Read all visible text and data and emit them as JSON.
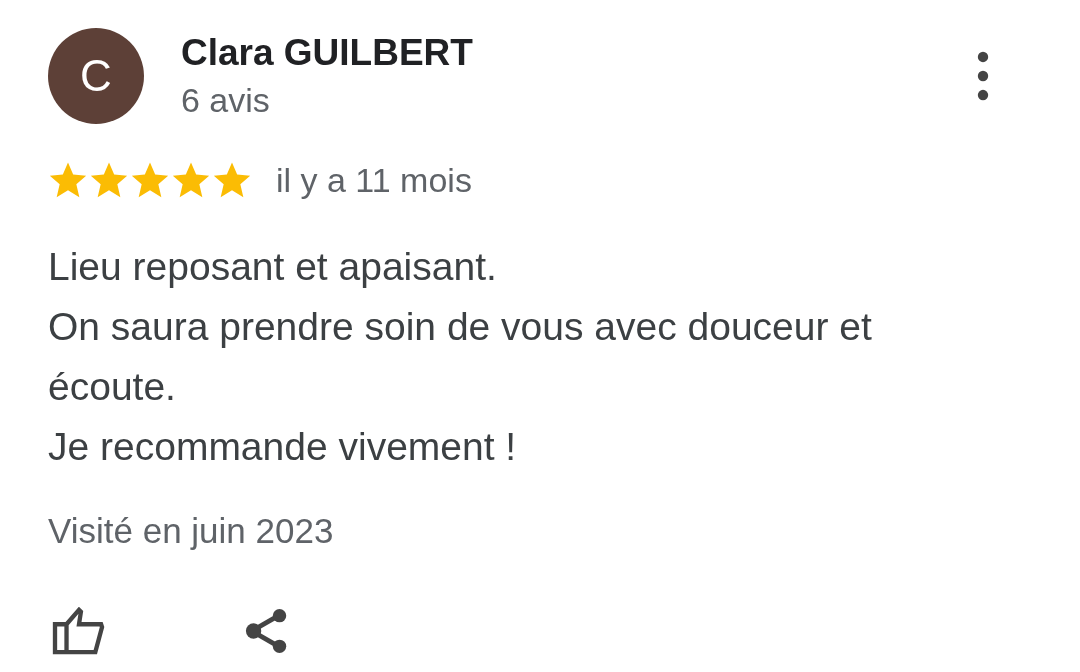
{
  "review": {
    "avatar_letter": "C",
    "author": "Clara GUILBERT",
    "review_count": "6 avis",
    "stars": 5,
    "time": "il y a 11 mois",
    "body_lines": [
      "Lieu reposant et apaisant.",
      "On saura prendre soin de vous avec douceur et écoute.",
      "Je recommande vivement !"
    ],
    "visited": "Visité en juin 2023"
  }
}
